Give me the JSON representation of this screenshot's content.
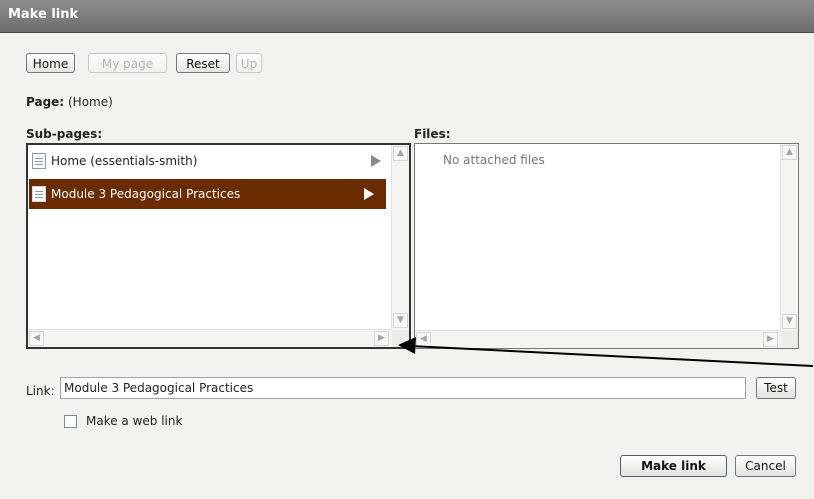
{
  "window": {
    "title": "Make link"
  },
  "toolbar": {
    "home": "Home",
    "my_page": "My page",
    "reset": "Reset",
    "up": "Up"
  },
  "page": {
    "label": "Page:",
    "value": "(Home)"
  },
  "subpages": {
    "heading": "Sub-pages:",
    "items": [
      {
        "label": "Home (essentials-smith)",
        "selected": false
      },
      {
        "label": "Module 3 Pedagogical Practices",
        "selected": true
      }
    ]
  },
  "files": {
    "heading": "Files:",
    "empty_text": "No attached files"
  },
  "link": {
    "label": "Link:",
    "value": "Module 3 Pedagogical Practices",
    "test_button": "Test"
  },
  "web_link": {
    "label": "Make a web link",
    "checked": false
  },
  "actions": {
    "make_link": "Make link",
    "cancel": "Cancel"
  },
  "colors": {
    "selection": "#6b2b00",
    "titlebar": "#7a7a7a"
  }
}
